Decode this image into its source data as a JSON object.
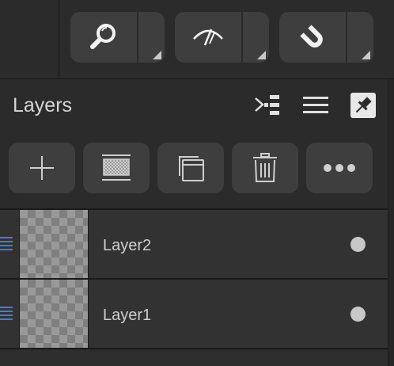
{
  "toolbar": {
    "tools": [
      {
        "name": "zoom",
        "icon": "magnifier-icon"
      },
      {
        "name": "view",
        "icon": "eye-slash-icon"
      },
      {
        "name": "snap",
        "icon": "magnet-icon"
      }
    ]
  },
  "layers_panel": {
    "title": "Layers",
    "header_icons": [
      "collapse-list-icon",
      "menu-icon",
      "pin-icon"
    ],
    "actions": [
      "add-layer",
      "mask",
      "duplicate",
      "delete",
      "more"
    ]
  },
  "layers": [
    {
      "name": "Layer2",
      "visible": true
    },
    {
      "name": "Layer1",
      "visible": true
    }
  ],
  "colors": {
    "background": "#2b2b2b",
    "button": "#3e3e3e",
    "visibility_bar": "#3f7fd8"
  }
}
